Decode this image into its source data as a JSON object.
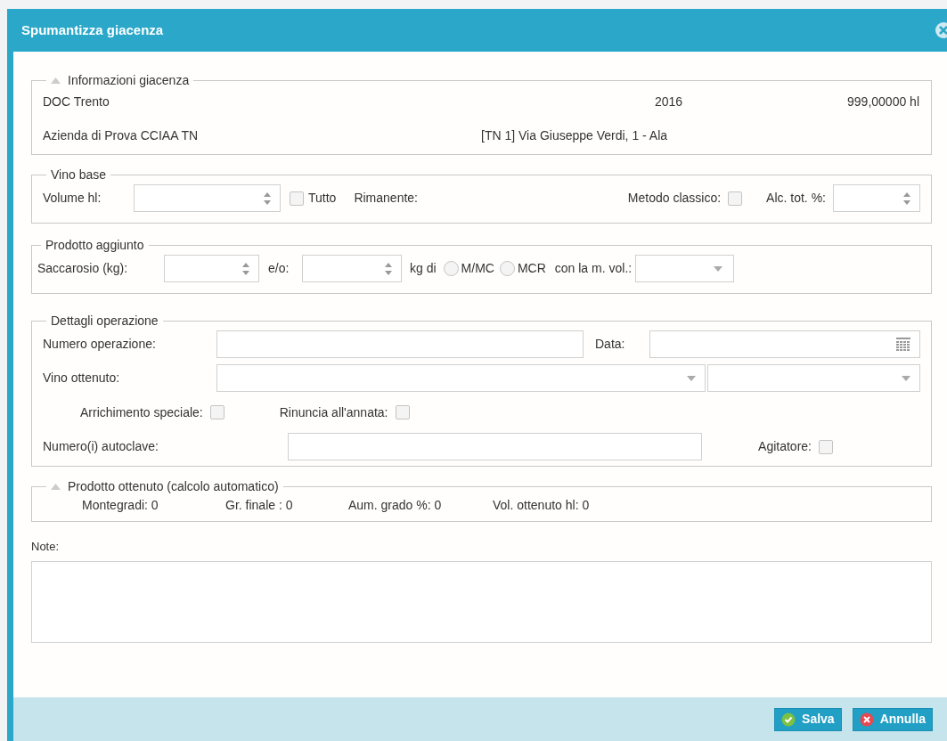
{
  "window": {
    "title": "Spumantizza giacenza"
  },
  "info": {
    "legend": "Informazioni giacenza",
    "expanded": true,
    "wine": "DOC Trento",
    "year": "2016",
    "quantity": "999,00000 hl",
    "company": "Azienda di Prova CCIAA TN",
    "address": "[TN 1] Via Giuseppe Verdi, 1 - Ala"
  },
  "vino_base": {
    "legend": "Vino base",
    "volume_label": "Volume hl:",
    "tutto": {
      "label": "Tutto",
      "checked": false
    },
    "rimanente_label": "Rimanente:",
    "metodo_classico": {
      "label": "Metodo classico:",
      "checked": false
    },
    "alc_label": "Alc. tot. %:"
  },
  "prodotto_aggiunto": {
    "legend": "Prodotto aggiunto",
    "saccarosio_label": "Saccarosio (kg):",
    "eo_label": "e/o:",
    "kg_di_label": "kg di",
    "radios": [
      {
        "label": "M/MC",
        "selected": false
      },
      {
        "label": "MCR",
        "selected": false
      }
    ],
    "vol_label": "con la m. vol.:"
  },
  "dettagli": {
    "legend": "Dettagli operazione",
    "numero_label": "Numero operazione:",
    "data_label": "Data:",
    "vino_label": "Vino ottenuto:",
    "arricchimento": {
      "label": "Arrichimento speciale:",
      "checked": false
    },
    "rinuncia": {
      "label": "Rinuncia all'annata:",
      "checked": false
    },
    "autoclave_label": "Numero(i) autoclave:",
    "agitatore": {
      "label": "Agitatore:",
      "checked": false
    }
  },
  "prodotto_ottenuto": {
    "legend": "Prodotto ottenuto (calcolo automatico)",
    "expanded": true,
    "stats": [
      "Montegradi: 0",
      "Gr. finale : 0",
      "Aum. grado %: 0",
      "Vol. ottenuto hl: 0"
    ]
  },
  "note": {
    "label": "Note:"
  },
  "buttons": [
    {
      "kind": "save",
      "label": "Salva"
    },
    {
      "kind": "cancel",
      "label": "Annulla"
    }
  ]
}
